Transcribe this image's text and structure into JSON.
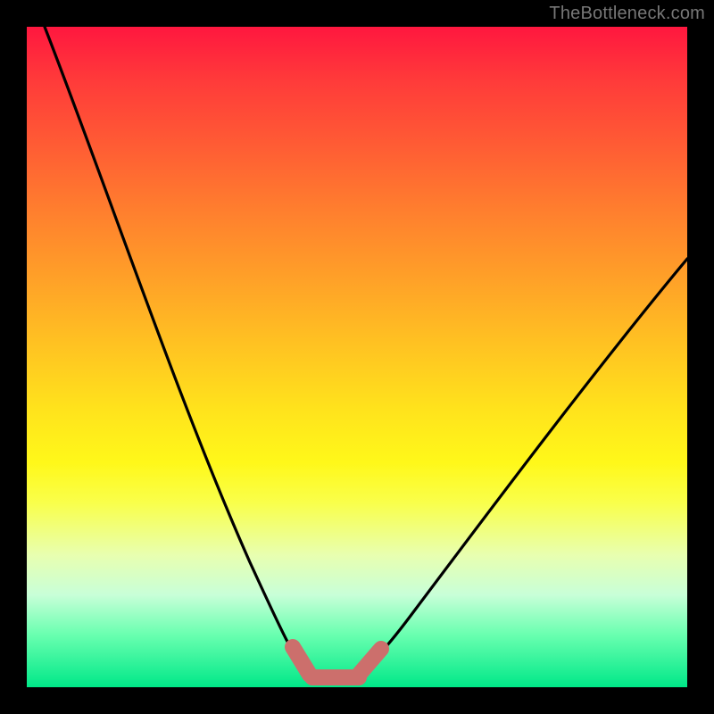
{
  "watermark": "TheBottleneck.com",
  "colors": {
    "frame": "#000000",
    "curve": "#000000",
    "optimal_marker": "#cc6f6c",
    "grad_top": "#ff173f",
    "grad_bottom": "#00e888"
  },
  "chart_data": {
    "type": "line",
    "title": "",
    "xlabel": "",
    "ylabel": "",
    "xlim": [
      0,
      100
    ],
    "ylim": [
      0,
      100
    ],
    "grid": false,
    "series": [
      {
        "name": "bottleneck-curve",
        "x": [
          2,
          5,
          8,
          12,
          16,
          20,
          24,
          28,
          32,
          35,
          38,
          40,
          42,
          44,
          46,
          50,
          55,
          60,
          65,
          70,
          75,
          80,
          85,
          90,
          95,
          100
        ],
        "y": [
          100,
          90,
          80,
          70,
          60,
          50,
          42,
          34,
          26,
          20,
          14,
          8,
          4,
          1,
          0,
          0,
          2,
          8,
          15,
          22,
          29,
          36,
          43,
          49,
          56,
          62
        ]
      }
    ],
    "annotations": [
      {
        "name": "optimal-zone-marker",
        "x_range": [
          40,
          52
        ],
        "note": "pink marker near minimum"
      }
    ],
    "legend": false
  }
}
